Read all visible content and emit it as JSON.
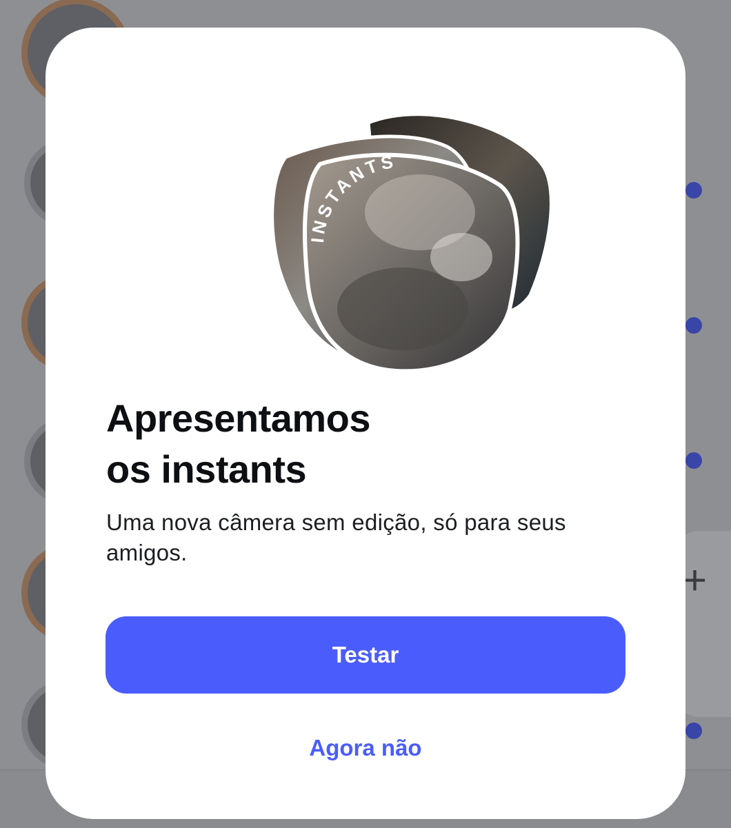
{
  "modal": {
    "badge_text": "INSTANTS",
    "title": "Apresentamos\nos instants",
    "subtitle": "Uma nova câmera sem edição, só para seus amigos.",
    "primary_button": "Testar",
    "secondary_button": "Agora não"
  },
  "colors": {
    "accent": "#4a5dfc",
    "title": "#0d0f12",
    "overlay": "#8e8f93"
  }
}
